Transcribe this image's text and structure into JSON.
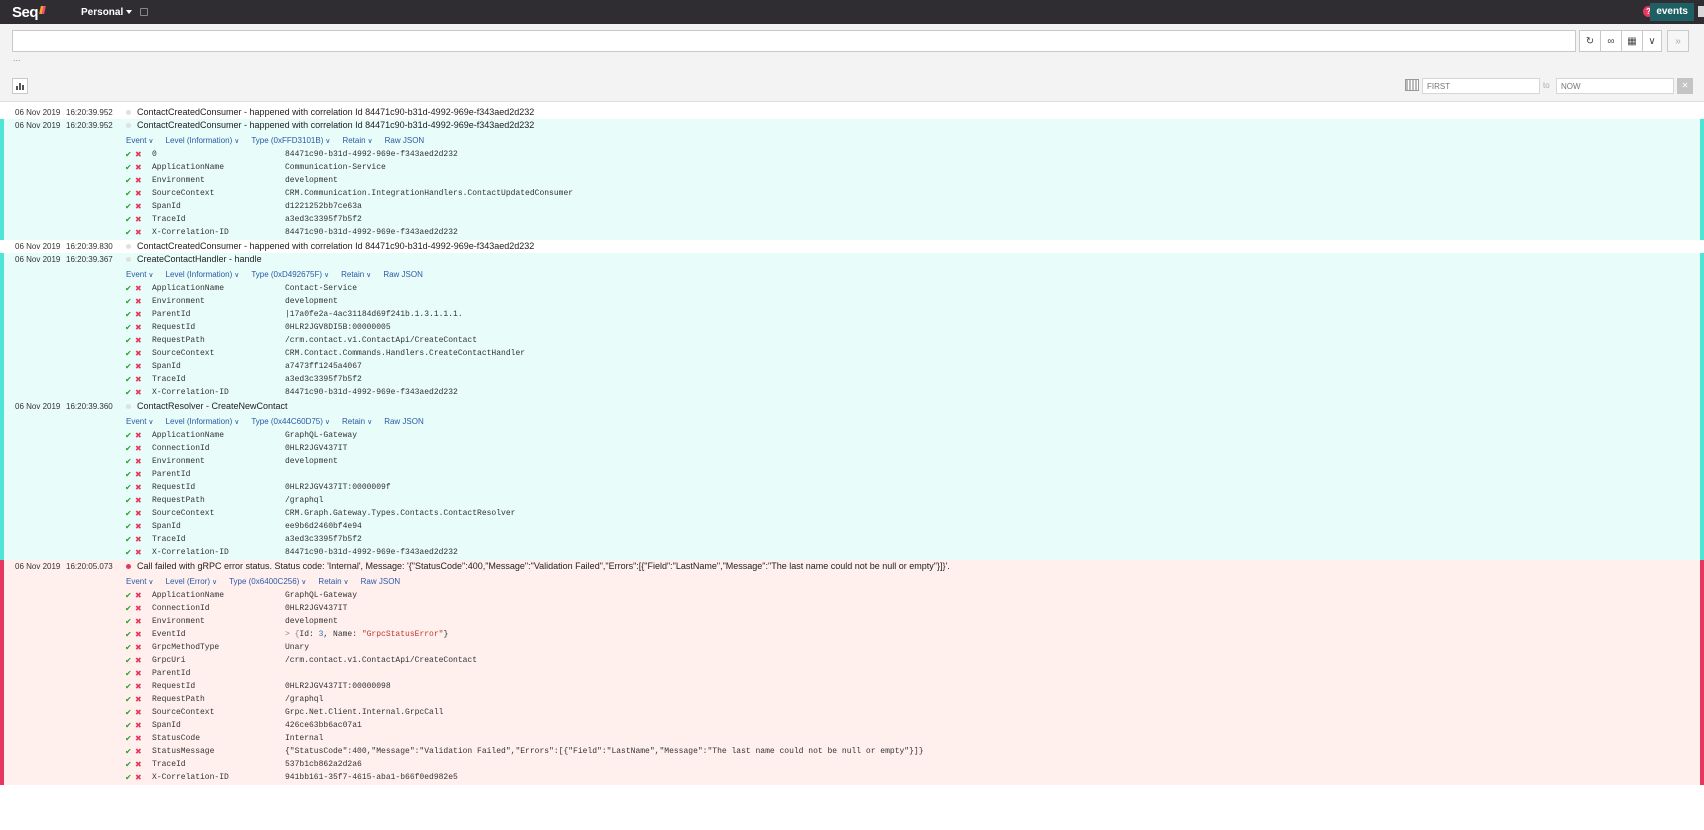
{
  "app": {
    "logo": "Seq",
    "workspace": "Personal",
    "nav_events": "events",
    "help": "?"
  },
  "search": {
    "value": "",
    "ellipsis": "...",
    "from_placeholder": "FIRST",
    "to_label": "to",
    "to_placeholder": "NOW"
  },
  "toolbar_icons": [
    "refresh-icon",
    "link-icon",
    "layout-icon",
    "chevron-down-icon",
    "fast-forward-icon"
  ],
  "actions": {
    "event": "Event",
    "retain": "Retain",
    "raw_json": "Raw JSON"
  },
  "colors": {
    "info_bg": "#e8fcf9",
    "info_bar": "#4fe5d4",
    "error_bg": "#fff0ee",
    "error_bar": "#e6385f",
    "topbar": "#2f2d32"
  },
  "events": [
    {
      "date": "06 Nov 2019",
      "time": "16:20:39.952",
      "message": "ContactCreatedConsumer - happened with correlation Id 84471c90-b31d-4992-969e-f343aed2d232",
      "expanded": false
    },
    {
      "date": "06 Nov 2019",
      "time": "16:20:39.952",
      "message": "ContactCreatedConsumer - happened with correlation Id 84471c90-b31d-4992-969e-f343aed2d232",
      "expanded": true,
      "level": "info",
      "level_label": "Level (Information)",
      "type_label": "Type (0xFFD3101B)",
      "properties": [
        {
          "name": "0",
          "value": "84471c90-b31d-4992-969e-f343aed2d232"
        },
        {
          "name": "ApplicationName",
          "value": "Communication-Service"
        },
        {
          "name": "Environment",
          "value": "development"
        },
        {
          "name": "SourceContext",
          "value": "CRM.Communication.IntegrationHandlers.ContactUpdatedConsumer"
        },
        {
          "name": "SpanId",
          "value": "d1221252bb7ce63a"
        },
        {
          "name": "TraceId",
          "value": "a3ed3c3395f7b5f2"
        },
        {
          "name": "X-Correlation-ID",
          "value": "84471c90-b31d-4992-969e-f343aed2d232"
        }
      ]
    },
    {
      "date": "06 Nov 2019",
      "time": "16:20:39.830",
      "message": "ContactCreatedConsumer - happened with correlation Id 84471c90-b31d-4992-969e-f343aed2d232",
      "expanded": false
    },
    {
      "date": "06 Nov 2019",
      "time": "16:20:39.367",
      "message": "CreateContactHandler - handle",
      "expanded": true,
      "level": "info",
      "level_label": "Level (Information)",
      "type_label": "Type (0xD492675F)",
      "properties": [
        {
          "name": "ApplicationName",
          "value": "Contact-Service"
        },
        {
          "name": "Environment",
          "value": "development"
        },
        {
          "name": "ParentId",
          "value": "|17a0fe2a-4ac31184d69f241b.1.3.1.1.1."
        },
        {
          "name": "RequestId",
          "value": "0HLR2JGV8DI5B:00000005"
        },
        {
          "name": "RequestPath",
          "value": "/crm.contact.v1.ContactApi/CreateContact"
        },
        {
          "name": "SourceContext",
          "value": "CRM.Contact.Commands.Handlers.CreateContactHandler"
        },
        {
          "name": "SpanId",
          "value": "a7473ff1245a4067"
        },
        {
          "name": "TraceId",
          "value": "a3ed3c3395f7b5f2"
        },
        {
          "name": "X-Correlation-ID",
          "value": "84471c90-b31d-4992-969e-f343aed2d232"
        }
      ]
    },
    {
      "date": "06 Nov 2019",
      "time": "16:20:39.360",
      "message": "ContactResolver - CreateNewContact",
      "expanded": true,
      "level": "info",
      "level_label": "Level (Information)",
      "type_label": "Type (0x44C60D75)",
      "properties": [
        {
          "name": "ApplicationName",
          "value": "GraphQL-Gateway"
        },
        {
          "name": "ConnectionId",
          "value": "0HLR2JGV437IT"
        },
        {
          "name": "Environment",
          "value": "development"
        },
        {
          "name": "ParentId",
          "value": ""
        },
        {
          "name": "RequestId",
          "value": "0HLR2JGV437IT:0000009f"
        },
        {
          "name": "RequestPath",
          "value": "/graphql"
        },
        {
          "name": "SourceContext",
          "value": "CRM.Graph.Gateway.Types.Contacts.ContactResolver"
        },
        {
          "name": "SpanId",
          "value": "ee9b6d2460bf4e94"
        },
        {
          "name": "TraceId",
          "value": "a3ed3c3395f7b5f2"
        },
        {
          "name": "X-Correlation-ID",
          "value": "84471c90-b31d-4992-969e-f343aed2d232"
        }
      ]
    },
    {
      "date": "06 Nov 2019",
      "time": "16:20:05.073",
      "message": "Call failed with gRPC error status. Status code: 'Internal', Message: '{\"StatusCode\":400,\"Message\":\"Validation Failed\",\"Errors\":[{\"Field\":\"LastName\",\"Message\":\"The last name could not be null or empty\"}]}'.",
      "expanded": true,
      "level": "error",
      "level_label": "Level (Error)",
      "type_label": "Type (0x6400C256)",
      "properties": [
        {
          "name": "ApplicationName",
          "value": "GraphQL-Gateway"
        },
        {
          "name": "ConnectionId",
          "value": "0HLR2JGV437IT"
        },
        {
          "name": "Environment",
          "value": "development"
        },
        {
          "name": "EventId",
          "value": "",
          "rich": true,
          "rich_prefix": "> {",
          "rich_k1": "Id: ",
          "rich_v1": "3",
          "rich_mid": ", Name: ",
          "rich_v2": "\"GrpcStatusError\"",
          "rich_suffix": "}"
        },
        {
          "name": "GrpcMethodType",
          "value": "Unary"
        },
        {
          "name": "GrpcUri",
          "value": "/crm.contact.v1.ContactApi/CreateContact"
        },
        {
          "name": "ParentId",
          "value": ""
        },
        {
          "name": "RequestId",
          "value": "0HLR2JGV437IT:00000098"
        },
        {
          "name": "RequestPath",
          "value": "/graphql"
        },
        {
          "name": "SourceContext",
          "value": "Grpc.Net.Client.Internal.GrpcCall"
        },
        {
          "name": "SpanId",
          "value": "426ce63bb6ac07a1"
        },
        {
          "name": "StatusCode",
          "value": "Internal"
        },
        {
          "name": "StatusMessage",
          "value": "{\"StatusCode\":400,\"Message\":\"Validation Failed\",\"Errors\":[{\"Field\":\"LastName\",\"Message\":\"The last name could not be null or empty\"}]}"
        },
        {
          "name": "TraceId",
          "value": "537b1cb862a2d2a6"
        },
        {
          "name": "X-Correlation-ID",
          "value": "941bb161-35f7-4615-aba1-b66f0ed982e5"
        }
      ]
    }
  ]
}
